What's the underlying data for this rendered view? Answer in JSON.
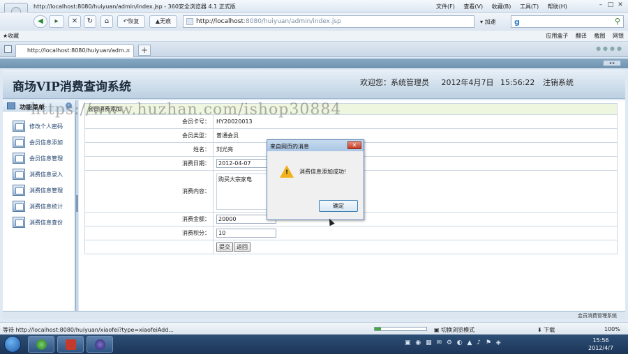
{
  "browser": {
    "title": "http://localhost:8080/huiyuan/admin/index.jsp - 360安全浏览器 4.1 正式版",
    "menu": [
      "文件(F)",
      "查看(V)",
      "收藏(B)",
      "工具(T)",
      "帮助(H)"
    ],
    "back_label": "◀",
    "forward_label": "▸",
    "restore_label": "恢复",
    "nohistory_label": "无痕",
    "address_host": "http://localhost",
    "address_rest": ":8080/huiyuan/admin/index.jsp",
    "speed_label": "加速",
    "favorites_label": "收藏",
    "fav_right": [
      "应用盒子",
      "翻译",
      "截图",
      "网银"
    ],
    "tab_title": "http://localhost:8080/huiyuan/adm...",
    "new_tab_label": "+"
  },
  "header": {
    "app_title": "商场VIP消费查询系统",
    "welcome_label": "欢迎您：",
    "user_name": "系统管理员",
    "date": "2012年4月7日",
    "time": "15:56:22",
    "logout": "注销系统"
  },
  "sidebar": {
    "title": "功能菜单",
    "items": [
      {
        "label": "修改个人密码"
      },
      {
        "label": "会员信息添加"
      },
      {
        "label": "会员信息管理"
      },
      {
        "label": "消费信息录入"
      },
      {
        "label": "消费信息管理"
      },
      {
        "label": "消费信息统计"
      },
      {
        "label": "消费信息查份"
      }
    ]
  },
  "form": {
    "caption": "会员消费添加",
    "card_label": "会员卡号：",
    "card_value": "HY20020013",
    "type_label": "会员类型：",
    "type_value": "普通会员",
    "name_label": "姓名：",
    "name_value": "刘光亮",
    "date_label": "消费日期：",
    "date_value": "2012-04-07",
    "content_label": "消费内容：",
    "content_value": "购买大宗家电",
    "amount_label": "消费金额：",
    "amount_value": "20000",
    "points_label": "消费积分：",
    "points_value": "10",
    "submit_label": "提交",
    "back_label": "返回"
  },
  "watermark": "https://www.huzhan.com/ishop30884",
  "dialog": {
    "title": "来自网页的消息",
    "message": "消费信息添加成功!",
    "ok_label": "确定",
    "close_label": "✕"
  },
  "footer": {
    "text": "会员消费管理系统"
  },
  "status": {
    "text": "等待 http://localhost:8080/huiyuan/xiaofei?type=xiaofeiAdd...",
    "progress": 0.12,
    "mode_label": "切换浏览模式",
    "download_label": "下载",
    "zoom": "100%"
  },
  "taskbar": {
    "time": "15:56",
    "date": "2012/4/7"
  },
  "colors": {
    "caption_bg": "#eef6df",
    "banner": "#bcd0e2",
    "taskbar": "#1c3558"
  }
}
